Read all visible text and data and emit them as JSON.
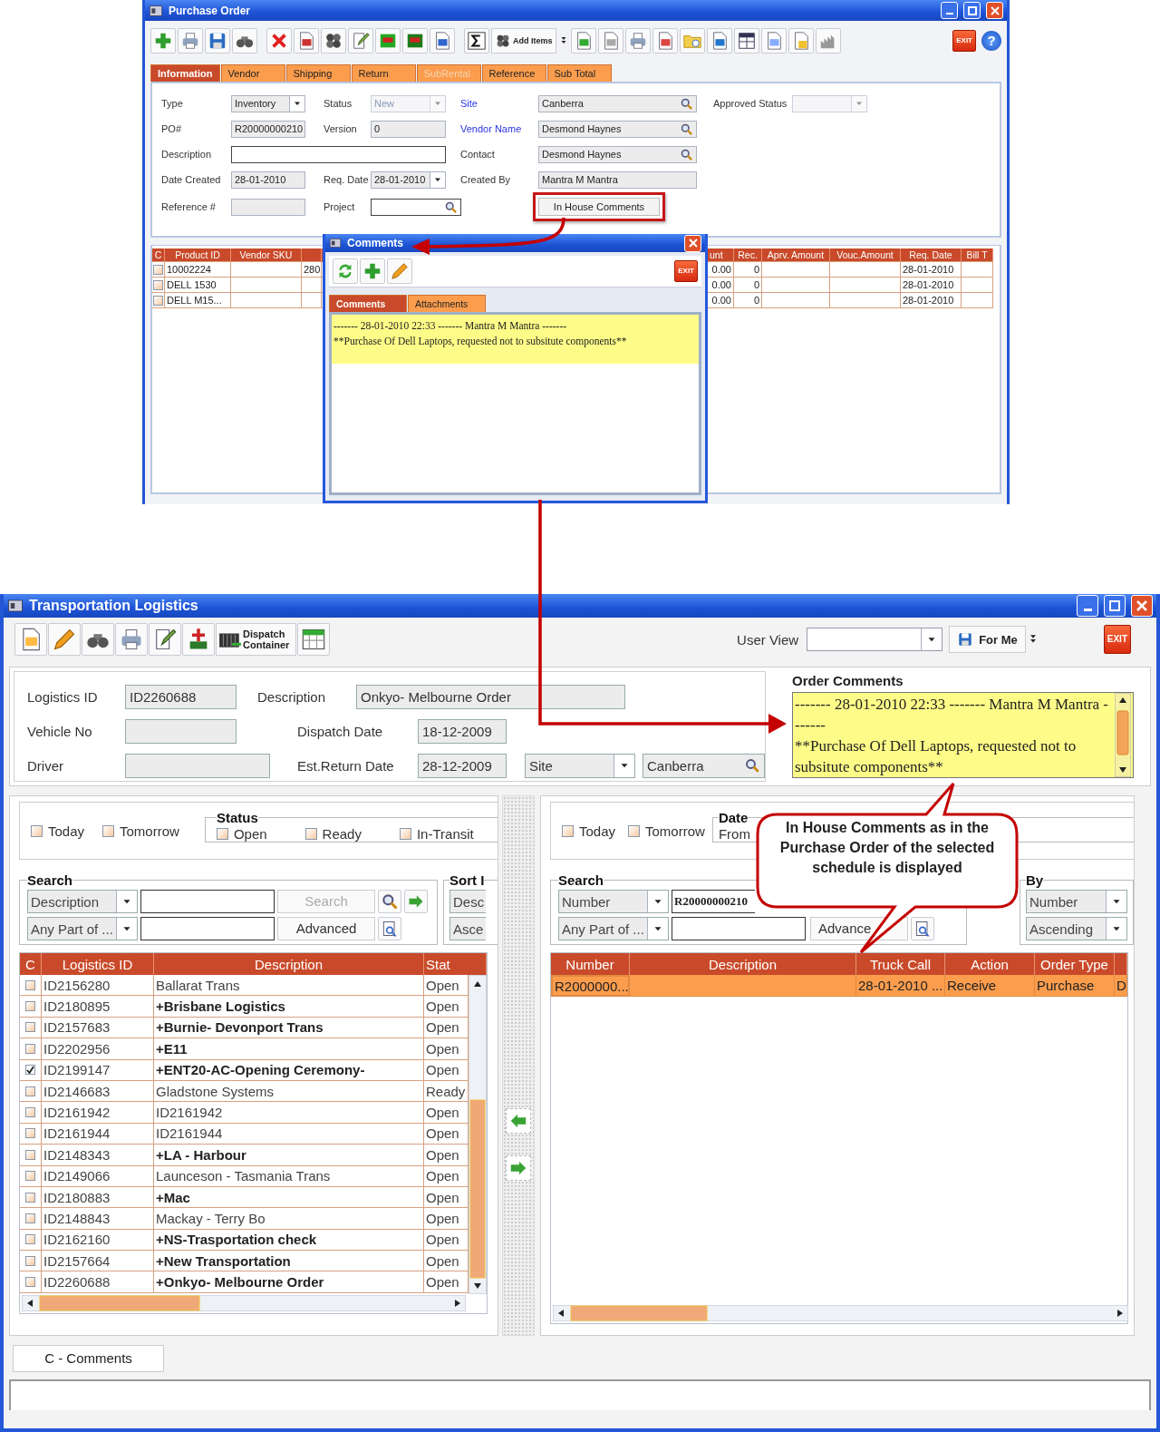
{
  "purchase_order": {
    "title": "Purchase Order",
    "toolbar": {
      "add_items": "Add Items",
      "exit": "EXIT",
      "help": "?"
    },
    "tabs": [
      {
        "label": "Information",
        "selected": true,
        "disabled": false
      },
      {
        "label": "Vendor",
        "selected": false,
        "disabled": false
      },
      {
        "label": "Shipping",
        "selected": false,
        "disabled": false
      },
      {
        "label": "Return",
        "selected": false,
        "disabled": false
      },
      {
        "label": "SubRental",
        "selected": false,
        "disabled": true
      },
      {
        "label": "Reference",
        "selected": false,
        "disabled": false
      },
      {
        "label": "Sub Total",
        "selected": false,
        "disabled": false
      }
    ],
    "form_rows": [
      [
        {
          "label": "Type",
          "value": "Inventory",
          "kind": "dropdown",
          "disabled": false,
          "link": false
        },
        {
          "label": "Status",
          "value": "New",
          "kind": "dropdown",
          "disabled": true,
          "link": false
        },
        {
          "label": "Site",
          "value": "Canberra",
          "kind": "lookup",
          "link": true
        },
        {
          "label": "Approved Status",
          "kind": "dropdown",
          "disabled": true,
          "link": false
        }
      ],
      [
        {
          "label": "PO#",
          "value": "R20000000210",
          "kind": "readonly",
          "link": false
        },
        {
          "label": "Version",
          "value": "0",
          "kind": "readonly",
          "link": false
        },
        {
          "label": "Vendor Name",
          "value": "Desmond Haynes",
          "kind": "lookup",
          "link": true
        }
      ],
      [
        {
          "label": "Description",
          "kind": "wide",
          "link": false
        },
        {
          "label": "Contact",
          "value": "Desmond Haynes",
          "kind": "lookup",
          "link": false
        }
      ],
      [
        {
          "label": "Date Created",
          "value": "28-01-2010",
          "kind": "readonly",
          "link": false
        },
        {
          "label": "Req. Date",
          "value": "28-01-2010",
          "kind": "date",
          "disabled": false,
          "link": false
        },
        {
          "label": "Created By",
          "value": "Mantra M Mantra",
          "kind": "readonly",
          "link": false
        }
      ],
      [
        {
          "label": "Reference #",
          "kind": "readonly",
          "link": false
        },
        {
          "label": "Project",
          "kind": "search",
          "link": false
        },
        {
          "value": "In House Comments",
          "kind": "button"
        }
      ]
    ],
    "product_table": {
      "columns": [
        "C",
        "Product ID",
        "Vendor SKU",
        "unt",
        "Rec.",
        "Aprv. Amount",
        "Vouc.Amount",
        "Req. Date",
        "Bill T"
      ],
      "rows": [
        {
          "checked": false,
          "product_id": "10002224",
          "column_4": "280",
          "amount": "0.00",
          "rec": "0",
          "req_date": "28-01-2010"
        },
        {
          "checked": false,
          "product_id": "DELL 1530",
          "amount": "0.00",
          "rec": "0",
          "req_date": "28-01-2010"
        },
        {
          "checked": false,
          "product_id": "DELL M15...",
          "amount": "0.00",
          "rec": "0",
          "req_date": "28-01-2010"
        }
      ]
    }
  },
  "comments_popup": {
    "title": "Comments",
    "exit": "EXIT",
    "tabs": [
      {
        "label": "Comments",
        "selected": true
      },
      {
        "label": "Attachments",
        "selected": false
      }
    ],
    "entry": {
      "header": "------- 28-01-2010 22:33 ------- Mantra M Mantra -------",
      "text": "**Purchase Of Dell Laptops, requested not to subsitute components**"
    }
  },
  "transportation": {
    "title": "Transportation Logistics",
    "toolbar": {
      "dispatch_container": "Dispatch Container",
      "user_view_label": "User View",
      "for_me": "For Me",
      "exit": "EXIT"
    },
    "header": {
      "logistics_id": {
        "label": "Logistics ID",
        "value": "ID2260688"
      },
      "description": {
        "label": "Description",
        "value": "Onkyo- Melbourne Order"
      },
      "vehicle_no": {
        "label": "Vehicle No"
      },
      "dispatch_date": {
        "label": "Dispatch Date",
        "value": "18-12-2009"
      },
      "driver": {
        "label": "Driver"
      },
      "est_return_date": {
        "label": "Est.Return Date",
        "value": "28-12-2009"
      },
      "site_type": "Site",
      "site": "Canberra"
    },
    "order_comments": {
      "title": "Order Comments",
      "header": "------- 28-01-2010 22:33 ------- Mantra M Mantra -------",
      "text": "**Purchase Of Dell Laptops, requested not to subsitute components**"
    },
    "left_panel": {
      "quick_filters": [
        {
          "label": "Today",
          "checked": false
        },
        {
          "label": "Tomorrow",
          "checked": false
        }
      ],
      "status": {
        "title": "Status",
        "options": [
          {
            "label": "Open",
            "checked": false
          },
          {
            "label": "Ready",
            "checked": false
          },
          {
            "label": "In-Transit",
            "checked": false
          }
        ]
      },
      "search": {
        "title": "Search",
        "field": "Description",
        "match": "Any Part of ...",
        "search_button": {
          "label": "Search",
          "disabled": true
        },
        "advanced_button": {
          "label": "Advanced",
          "disabled": false
        }
      },
      "sort": {
        "title": "Sort I",
        "field": "Desc",
        "order": "Asce"
      },
      "table": {
        "columns": [
          "C",
          "Logistics ID",
          "Description",
          "Stat"
        ],
        "rows": [
          {
            "checked": false,
            "id": "ID2156280",
            "description": "Ballarat Trans",
            "status": "Open",
            "emphasized": false
          },
          {
            "checked": false,
            "id": "ID2180895",
            "description": "+Brisbane Logistics",
            "status": "Open",
            "emphasized": true
          },
          {
            "checked": false,
            "id": "ID2157683",
            "description": "+Burnie- Devonport Trans",
            "status": "Open",
            "emphasized": true
          },
          {
            "checked": false,
            "id": "ID2202956",
            "description": "+E11",
            "status": "Open",
            "emphasized": true
          },
          {
            "checked": true,
            "id": "ID2199147",
            "description": "+ENT20-AC-Opening Ceremony-",
            "status": "Open",
            "emphasized": true
          },
          {
            "checked": false,
            "id": "ID2146683",
            "description": "Gladstone Systems",
            "status": "Ready",
            "emphasized": false
          },
          {
            "checked": false,
            "id": "ID2161942",
            "description": "ID2161942",
            "status": "Open",
            "emphasized": false
          },
          {
            "checked": false,
            "id": "ID2161944",
            "description": "ID2161944",
            "status": "Open",
            "emphasized": false
          },
          {
            "checked": false,
            "id": "ID2148343",
            "description": "+LA - Harbour",
            "status": "Open",
            "emphasized": true
          },
          {
            "checked": false,
            "id": "ID2149066",
            "description": "Launceson - Tasmania Trans",
            "status": "Open",
            "emphasized": false
          },
          {
            "checked": false,
            "id": "ID2180883",
            "description": "+Mac",
            "status": "Open",
            "emphasized": true
          },
          {
            "checked": false,
            "id": "ID2148843",
            "description": "Mackay - Terry Bo",
            "status": "Open",
            "emphasized": false
          },
          {
            "checked": false,
            "id": "ID2162160",
            "description": "+NS-Trasportation check",
            "status": "Open",
            "emphasized": true
          },
          {
            "checked": false,
            "id": "ID2157664",
            "description": "+New Transportation",
            "status": "Open",
            "emphasized": true
          },
          {
            "checked": false,
            "id": "ID2260688",
            "description": "+Onkyo- Melbourne Order",
            "status": "Open",
            "emphasized": true
          }
        ]
      }
    },
    "right_panel": {
      "quick_filters": [
        {
          "label": "Today",
          "checked": false
        },
        {
          "label": "Tomorrow",
          "checked": false
        }
      ],
      "date": {
        "title": "Date",
        "from_label": "From"
      },
      "search": {
        "title": "Search",
        "field": "Number",
        "value": "R20000000210",
        "match": "Any Part of ...",
        "advanced_button": {
          "label": "Advance",
          "disabled": false
        }
      },
      "sort": {
        "title": "By",
        "field": "Number",
        "order": "Ascending"
      },
      "table": {
        "columns": [
          "Number",
          "Description",
          "Truck Call",
          "Action",
          "Order Type"
        ],
        "rows": [
          {
            "selected": true,
            "number": "R2000000...",
            "truck_call": "28-01-2010 ...",
            "action": "Receive",
            "order_type": "Purchase",
            "column_6": "D"
          }
        ]
      }
    },
    "legend": "C - Comments"
  },
  "callout": "In House Comments as in the Purchase Order of the selected schedule is displayed"
}
